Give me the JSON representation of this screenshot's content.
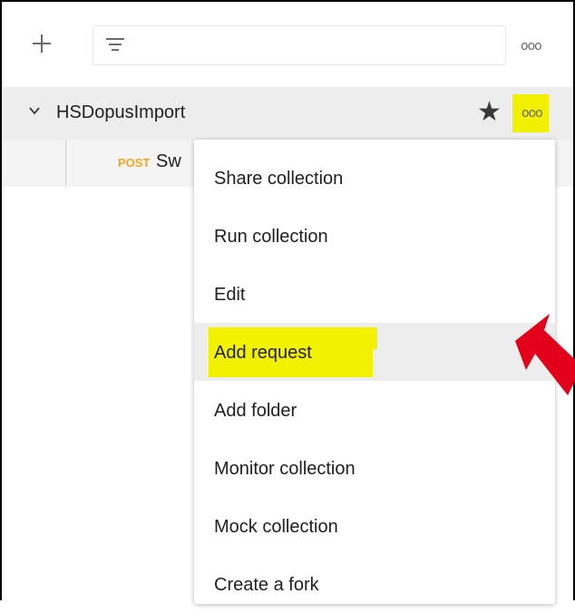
{
  "toolbar": {
    "new_icon": "plus-icon",
    "filter_icon": "filter-icon",
    "more_icon": "more-dots-icon",
    "more_glyph": "ooo"
  },
  "collection": {
    "name": "HSDopusImport",
    "star_glyph": "★",
    "more_glyph": "ooo"
  },
  "request": {
    "method": "POST",
    "name_visible": "Sw"
  },
  "context_menu": {
    "items": [
      {
        "label": "Share collection"
      },
      {
        "label": "Run collection"
      },
      {
        "label": "Edit"
      },
      {
        "label": "Add request"
      },
      {
        "label": "Add folder"
      },
      {
        "label": "Monitor collection"
      },
      {
        "label": "Mock collection"
      },
      {
        "label": "Create a fork"
      }
    ]
  },
  "colors": {
    "highlight": "#f2f200",
    "method_post": "#f5a623",
    "arrow": "#e2001a"
  }
}
